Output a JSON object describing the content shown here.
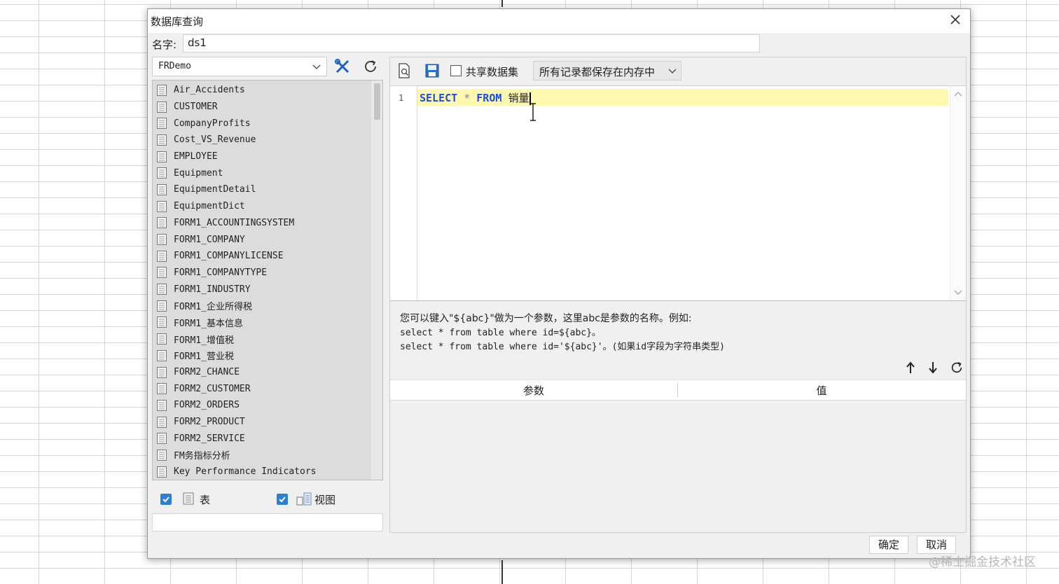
{
  "dialog": {
    "title": "数据库查询",
    "name_label": "名字:",
    "name_value": "ds1",
    "ok_label": "确定",
    "cancel_label": "取消"
  },
  "left": {
    "datasource": "FRDemo",
    "tables": [
      "Air_Accidents",
      "CUSTOMER",
      "CompanyProfits",
      "Cost_VS_Revenue",
      "EMPLOYEE",
      "Equipment",
      "EquipmentDetail",
      "EquipmentDict",
      "FORM1_ACCOUNTINGSYSTEM",
      "FORM1_COMPANY",
      "FORM1_COMPANYLICENSE",
      "FORM1_COMPANYTYPE",
      "FORM1_INDUSTRY",
      "FORM1_企业所得税",
      "FORM1_基本信息",
      "FORM1_增值税",
      "FORM1_营业税",
      "FORM2_CHANCE",
      "FORM2_CUSTOMER",
      "FORM2_ORDERS",
      "FORM2_PRODUCT",
      "FORM2_SERVICE",
      "FM务指标分析",
      "Key Performance Indicators"
    ],
    "filter_table_label": "表",
    "filter_view_label": "视图",
    "filter_table_checked": true,
    "filter_view_checked": true
  },
  "right": {
    "share_label": "共享数据集",
    "share_checked": false,
    "memory_option": "所有记录都保存在内存中",
    "line_number": "1",
    "sql_kw1": "SELECT",
    "sql_star": "*",
    "sql_kw2": "FROM",
    "sql_table": "销量",
    "hint_line1": "您可以键入\"${abc}\"做为一个参数，这里abc是参数的名称。例如:",
    "hint_line2": "select * from table where id=${abc}。",
    "hint_line3": "select * from table where id='${abc}'。(如果id字段为字符串类型)",
    "param_col1": "参数",
    "param_col2": "值"
  },
  "watermark": "@稀土掘金技术社区",
  "colors": {
    "accent": "#2d7fd6",
    "keyword": "#1a4fd6",
    "highlight_line": "#fff8b0"
  }
}
